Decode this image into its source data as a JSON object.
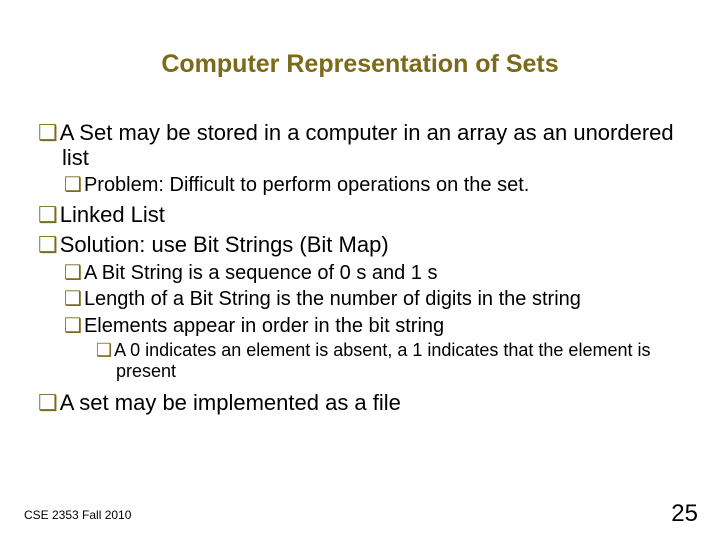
{
  "title": "Computer Representation of Sets",
  "bullets": {
    "b1": "A Set may be stored in a computer in an array as an unordered list",
    "b1a": "Problem: Difficult to perform operations on the set.",
    "b2": "Linked List",
    "b3": "Solution: use Bit Strings (Bit Map)",
    "b3a": "A Bit String is a sequence of 0 s and 1 s",
    "b3b": "Length of a Bit String is the number of digits in the string",
    "b3c": "Elements appear in order in the bit string",
    "b3c1": "A 0 indicates an element is absent, a 1 indicates that the element is present",
    "b4": "A set may be implemented as a file"
  },
  "footer": {
    "left": "CSE 2353 Fall 2010",
    "page": "25"
  },
  "bullet_glyph": "❑"
}
